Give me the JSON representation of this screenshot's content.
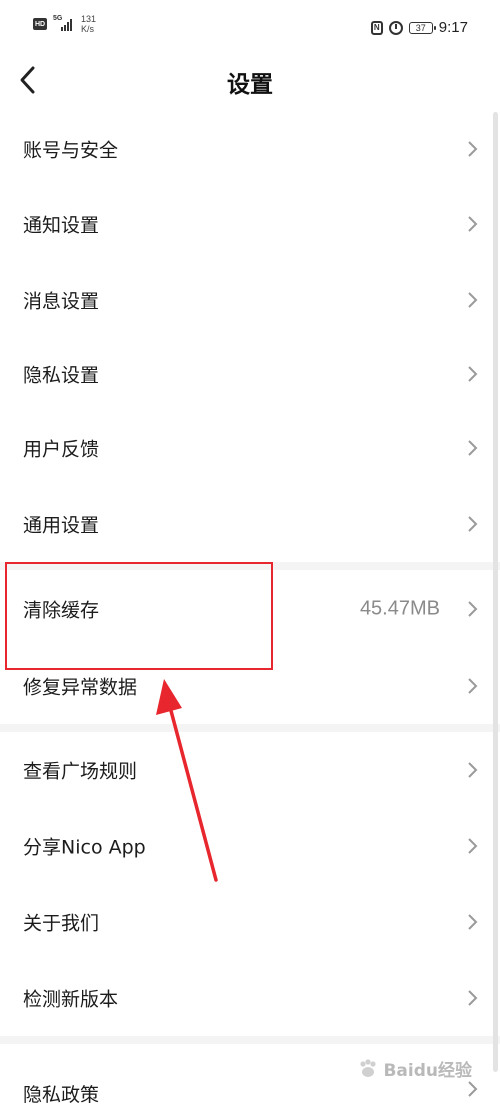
{
  "status_bar": {
    "hd": "HD",
    "network": "5G",
    "speed_value": "131",
    "speed_unit": "K/s",
    "nfc": "N",
    "battery": "37",
    "time": "9:17"
  },
  "nav": {
    "title": "设置"
  },
  "menu": {
    "group1": [
      {
        "label": "账号与安全"
      },
      {
        "label": "通知设置"
      },
      {
        "label": "消息设置"
      },
      {
        "label": "隐私设置"
      },
      {
        "label": "用户反馈"
      },
      {
        "label": "通用设置"
      }
    ],
    "group2": [
      {
        "label": "清除缓存",
        "value": "45.47MB"
      },
      {
        "label": "修复异常数据"
      }
    ],
    "group3": [
      {
        "label": "查看广场规则"
      },
      {
        "label": "分享Nico App"
      },
      {
        "label": "关于我们"
      },
      {
        "label": "检测新版本"
      }
    ],
    "group4": [
      {
        "label": "隐私政策"
      }
    ]
  },
  "annotation": {
    "highlight_color": "#e8262d"
  },
  "watermark": {
    "text": "Baidu经验"
  }
}
